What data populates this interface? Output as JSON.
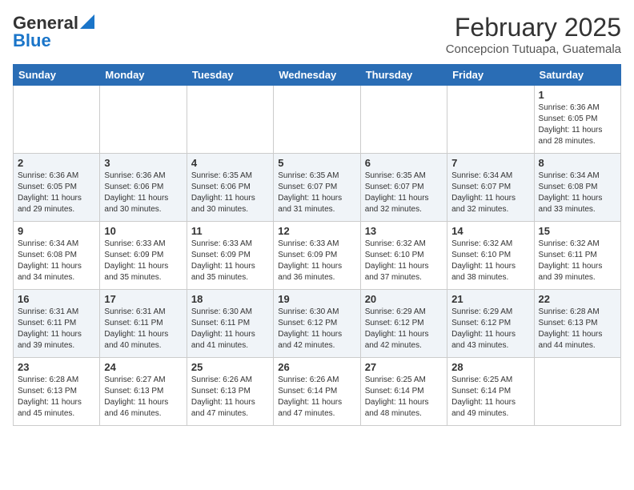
{
  "header": {
    "logo_general": "General",
    "logo_blue": "Blue",
    "month_year": "February 2025",
    "location": "Concepcion Tutuapa, Guatemala"
  },
  "weekdays": [
    "Sunday",
    "Monday",
    "Tuesday",
    "Wednesday",
    "Thursday",
    "Friday",
    "Saturday"
  ],
  "weeks": [
    [
      {
        "day": "",
        "info": ""
      },
      {
        "day": "",
        "info": ""
      },
      {
        "day": "",
        "info": ""
      },
      {
        "day": "",
        "info": ""
      },
      {
        "day": "",
        "info": ""
      },
      {
        "day": "",
        "info": ""
      },
      {
        "day": "1",
        "info": "Sunrise: 6:36 AM\nSunset: 6:05 PM\nDaylight: 11 hours and 28 minutes."
      }
    ],
    [
      {
        "day": "2",
        "info": "Sunrise: 6:36 AM\nSunset: 6:05 PM\nDaylight: 11 hours and 29 minutes."
      },
      {
        "day": "3",
        "info": "Sunrise: 6:36 AM\nSunset: 6:06 PM\nDaylight: 11 hours and 30 minutes."
      },
      {
        "day": "4",
        "info": "Sunrise: 6:35 AM\nSunset: 6:06 PM\nDaylight: 11 hours and 30 minutes."
      },
      {
        "day": "5",
        "info": "Sunrise: 6:35 AM\nSunset: 6:07 PM\nDaylight: 11 hours and 31 minutes."
      },
      {
        "day": "6",
        "info": "Sunrise: 6:35 AM\nSunset: 6:07 PM\nDaylight: 11 hours and 32 minutes."
      },
      {
        "day": "7",
        "info": "Sunrise: 6:34 AM\nSunset: 6:07 PM\nDaylight: 11 hours and 32 minutes."
      },
      {
        "day": "8",
        "info": "Sunrise: 6:34 AM\nSunset: 6:08 PM\nDaylight: 11 hours and 33 minutes."
      }
    ],
    [
      {
        "day": "9",
        "info": "Sunrise: 6:34 AM\nSunset: 6:08 PM\nDaylight: 11 hours and 34 minutes."
      },
      {
        "day": "10",
        "info": "Sunrise: 6:33 AM\nSunset: 6:09 PM\nDaylight: 11 hours and 35 minutes."
      },
      {
        "day": "11",
        "info": "Sunrise: 6:33 AM\nSunset: 6:09 PM\nDaylight: 11 hours and 35 minutes."
      },
      {
        "day": "12",
        "info": "Sunrise: 6:33 AM\nSunset: 6:09 PM\nDaylight: 11 hours and 36 minutes."
      },
      {
        "day": "13",
        "info": "Sunrise: 6:32 AM\nSunset: 6:10 PM\nDaylight: 11 hours and 37 minutes."
      },
      {
        "day": "14",
        "info": "Sunrise: 6:32 AM\nSunset: 6:10 PM\nDaylight: 11 hours and 38 minutes."
      },
      {
        "day": "15",
        "info": "Sunrise: 6:32 AM\nSunset: 6:11 PM\nDaylight: 11 hours and 39 minutes."
      }
    ],
    [
      {
        "day": "16",
        "info": "Sunrise: 6:31 AM\nSunset: 6:11 PM\nDaylight: 11 hours and 39 minutes."
      },
      {
        "day": "17",
        "info": "Sunrise: 6:31 AM\nSunset: 6:11 PM\nDaylight: 11 hours and 40 minutes."
      },
      {
        "day": "18",
        "info": "Sunrise: 6:30 AM\nSunset: 6:11 PM\nDaylight: 11 hours and 41 minutes."
      },
      {
        "day": "19",
        "info": "Sunrise: 6:30 AM\nSunset: 6:12 PM\nDaylight: 11 hours and 42 minutes."
      },
      {
        "day": "20",
        "info": "Sunrise: 6:29 AM\nSunset: 6:12 PM\nDaylight: 11 hours and 42 minutes."
      },
      {
        "day": "21",
        "info": "Sunrise: 6:29 AM\nSunset: 6:12 PM\nDaylight: 11 hours and 43 minutes."
      },
      {
        "day": "22",
        "info": "Sunrise: 6:28 AM\nSunset: 6:13 PM\nDaylight: 11 hours and 44 minutes."
      }
    ],
    [
      {
        "day": "23",
        "info": "Sunrise: 6:28 AM\nSunset: 6:13 PM\nDaylight: 11 hours and 45 minutes."
      },
      {
        "day": "24",
        "info": "Sunrise: 6:27 AM\nSunset: 6:13 PM\nDaylight: 11 hours and 46 minutes."
      },
      {
        "day": "25",
        "info": "Sunrise: 6:26 AM\nSunset: 6:13 PM\nDaylight: 11 hours and 47 minutes."
      },
      {
        "day": "26",
        "info": "Sunrise: 6:26 AM\nSunset: 6:14 PM\nDaylight: 11 hours and 47 minutes."
      },
      {
        "day": "27",
        "info": "Sunrise: 6:25 AM\nSunset: 6:14 PM\nDaylight: 11 hours and 48 minutes."
      },
      {
        "day": "28",
        "info": "Sunrise: 6:25 AM\nSunset: 6:14 PM\nDaylight: 11 hours and 49 minutes."
      },
      {
        "day": "",
        "info": ""
      }
    ]
  ]
}
